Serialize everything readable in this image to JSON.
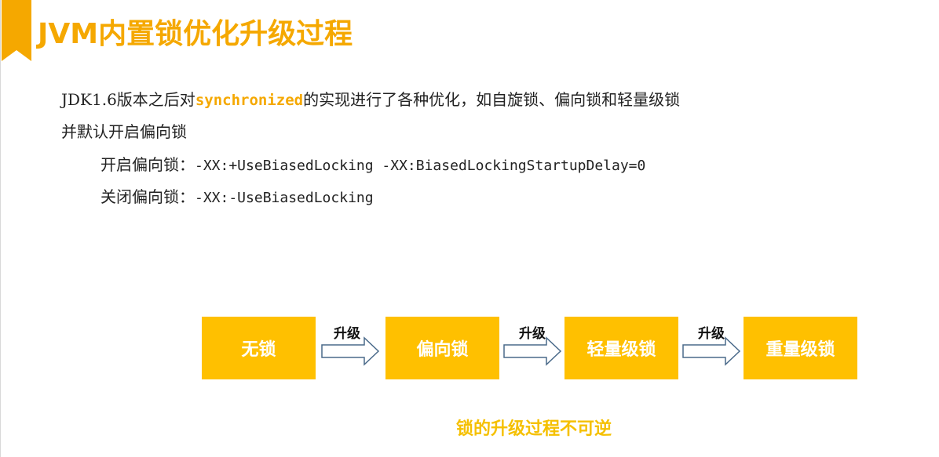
{
  "header": {
    "title": "JVM内置锁优化升级过程"
  },
  "content": {
    "line1": {
      "prefix": "JDK1.6版本之后对",
      "keyword": "synchronized",
      "suffix": "的实现进行了各种优化，如自旋锁、偏向锁和轻量级锁"
    },
    "line2": "并默认开启偏向锁",
    "enable": {
      "label": "开启偏向锁：",
      "value": "-XX:+UseBiasedLocking -XX:BiasedLockingStartupDelay=0"
    },
    "disable": {
      "label": "关闭偏向锁：",
      "value": "-XX:-UseBiasedLocking"
    }
  },
  "diagram": {
    "states": [
      "无锁",
      "偏向锁",
      "轻量级锁",
      "重量级锁"
    ],
    "transitions": [
      "升级",
      "升级",
      "升级"
    ],
    "caption": "锁的升级过程不可逆"
  },
  "colors": {
    "accent": "#f5a800",
    "box": "#ffc000",
    "arrow_stroke": "#4a6a8a"
  }
}
